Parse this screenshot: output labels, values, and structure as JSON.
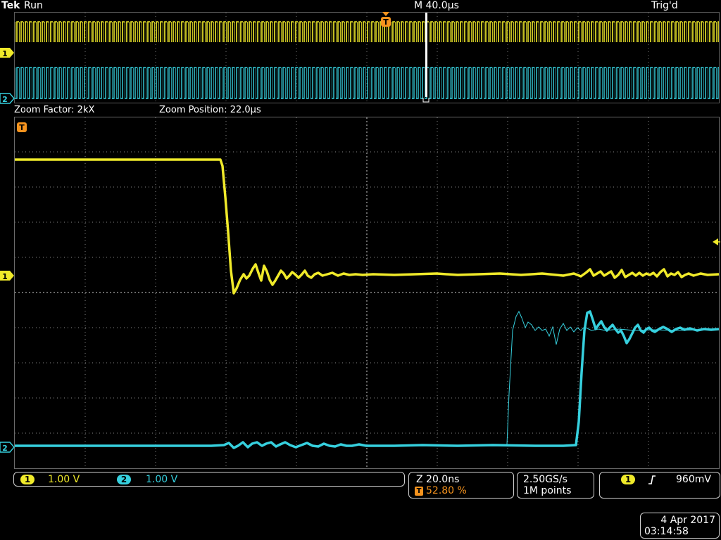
{
  "header": {
    "brand": "Tek",
    "run_state": "Run",
    "timebase": "M 40.0µs",
    "trigger_status": "Trig'd",
    "trigger_marker": "T"
  },
  "zoom": {
    "factor_label": "Zoom Factor: 2kX",
    "position_label": "Zoom Position: 22.0µs"
  },
  "channels": [
    {
      "id": "1",
      "scale": "1.00 V",
      "color": "#f0ea2a"
    },
    {
      "id": "2",
      "scale": "1.00 V",
      "color": "#36d0de"
    }
  ],
  "horizontal": {
    "zoom_scale": "Z 20.0ns",
    "trigger_marker": "T",
    "trigger_position": "52.80 %"
  },
  "acquisition": {
    "sample_rate": "2.50GS/s",
    "record_length": "1M points"
  },
  "trigger": {
    "source": "1",
    "slope_icon": "rising-edge-icon",
    "level": "960mV"
  },
  "datetime": {
    "date": "4 Apr  2017",
    "time": "03:14:58"
  },
  "colors": {
    "ch1": "#f0ea2a",
    "ch2": "#36d0de",
    "trigger": "#f5931e",
    "grid": "#9a9a9a"
  }
}
